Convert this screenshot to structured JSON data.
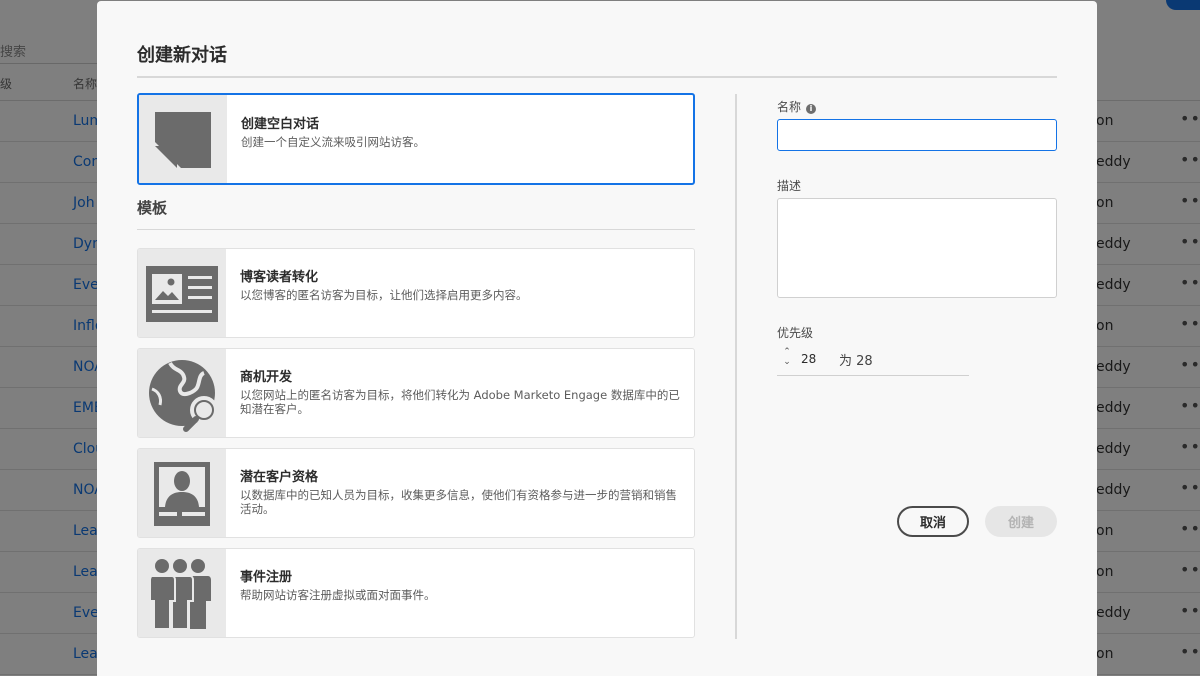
{
  "background": {
    "search_placeholder": "搜索",
    "columns": {
      "priority": "级",
      "name": "名称"
    },
    "rows": [
      {
        "name": "Lum",
        "owner": "on"
      },
      {
        "name": "Con",
        "owner": "eddy"
      },
      {
        "name": "Joh",
        "owner": "on"
      },
      {
        "name": "Dyn",
        "owner": "eddy"
      },
      {
        "name": "Eve",
        "owner": "eddy"
      },
      {
        "name": "Inflo",
        "owner": "on"
      },
      {
        "name": "NOA",
        "owner": "eddy"
      },
      {
        "name": "EME",
        "owner": "eddy"
      },
      {
        "name": "Clou",
        "owner": "eddy"
      },
      {
        "name": "NOA",
        "owner": "eddy"
      },
      {
        "name": "Lea",
        "owner": "on"
      },
      {
        "name": "Lea",
        "owner": "on"
      },
      {
        "name": "Eve",
        "owner": "eddy"
      },
      {
        "name": "Lea",
        "owner": "on"
      }
    ],
    "more_label": "•••"
  },
  "dialog": {
    "title": "创建新对话",
    "blank": {
      "title": "创建空白对话",
      "description": "创建一个自定义流来吸引网站访客。"
    },
    "templates_label": "模板",
    "templates": [
      {
        "title": "博客读者转化",
        "description": "以您博客的匿名访客为目标，让他们选择启用更多内容。",
        "icon": "blog-article-icon"
      },
      {
        "title": "商机开发",
        "description": "以您网站上的匿名访客为目标，将他们转化为 Adobe Marketo Engage 数据库中的已知潜在客户。",
        "icon": "globe-search-icon"
      },
      {
        "title": "潜在客户资格",
        "description": "以数据库中的已知人员为目标，收集更多信息，使他们有资格参与进一步的营销和销售活动。",
        "icon": "person-badge-icon"
      },
      {
        "title": "事件注册",
        "description": "帮助网站访客注册虚拟或面对面事件。",
        "icon": "people-group-icon"
      }
    ],
    "form": {
      "name_label": "名称",
      "name_value": "",
      "description_label": "描述",
      "description_value": "",
      "priority_label": "优先级",
      "priority_value": "28",
      "priority_text": "为 28"
    },
    "buttons": {
      "cancel": "取消",
      "create": "创建"
    }
  },
  "colors": {
    "accent": "#1473e6",
    "icon_fill": "#6b6b6b",
    "icon_bg": "#e9e9e9"
  }
}
